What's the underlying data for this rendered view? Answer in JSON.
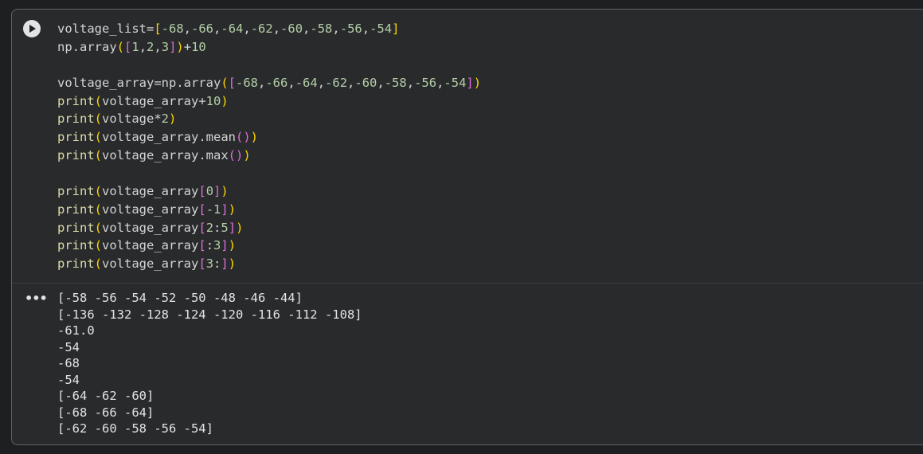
{
  "cell": {
    "run_icon": "play-icon",
    "code_lines": [
      [
        [
          "plain",
          "voltage_list="
        ],
        [
          "p1",
          "["
        ],
        [
          "num",
          "-68"
        ],
        [
          "plain",
          ","
        ],
        [
          "num",
          "-66"
        ],
        [
          "plain",
          ","
        ],
        [
          "num",
          "-64"
        ],
        [
          "plain",
          ","
        ],
        [
          "num",
          "-62"
        ],
        [
          "plain",
          ","
        ],
        [
          "num",
          "-60"
        ],
        [
          "plain",
          ","
        ],
        [
          "num",
          "-58"
        ],
        [
          "plain",
          ","
        ],
        [
          "num",
          "-56"
        ],
        [
          "plain",
          ","
        ],
        [
          "num",
          "-54"
        ],
        [
          "p1",
          "]"
        ]
      ],
      [
        [
          "plain",
          "np.array"
        ],
        [
          "p1",
          "("
        ],
        [
          "p2",
          "["
        ],
        [
          "num",
          "1"
        ],
        [
          "plain",
          ","
        ],
        [
          "num",
          "2"
        ],
        [
          "plain",
          ","
        ],
        [
          "num",
          "3"
        ],
        [
          "p2",
          "]"
        ],
        [
          "p1",
          ")"
        ],
        [
          "plain",
          "+"
        ],
        [
          "num",
          "10"
        ]
      ],
      [],
      [
        [
          "plain",
          "voltage_array=np.array"
        ],
        [
          "p1",
          "("
        ],
        [
          "p2",
          "["
        ],
        [
          "num",
          "-68"
        ],
        [
          "plain",
          ","
        ],
        [
          "num",
          "-66"
        ],
        [
          "plain",
          ","
        ],
        [
          "num",
          "-64"
        ],
        [
          "plain",
          ","
        ],
        [
          "num",
          "-62"
        ],
        [
          "plain",
          ","
        ],
        [
          "num",
          "-60"
        ],
        [
          "plain",
          ","
        ],
        [
          "num",
          "-58"
        ],
        [
          "plain",
          ","
        ],
        [
          "num",
          "-56"
        ],
        [
          "plain",
          ","
        ],
        [
          "num",
          "-54"
        ],
        [
          "p2",
          "]"
        ],
        [
          "p1",
          ")"
        ]
      ],
      [
        [
          "fn",
          "print"
        ],
        [
          "p1",
          "("
        ],
        [
          "plain",
          "voltage_array+"
        ],
        [
          "num",
          "10"
        ],
        [
          "p1",
          ")"
        ]
      ],
      [
        [
          "fn",
          "print"
        ],
        [
          "p1",
          "("
        ],
        [
          "plain",
          "voltage*"
        ],
        [
          "num",
          "2"
        ],
        [
          "p1",
          ")"
        ]
      ],
      [
        [
          "fn",
          "print"
        ],
        [
          "p1",
          "("
        ],
        [
          "plain",
          "voltage_array.mean"
        ],
        [
          "p2",
          "()"
        ],
        [
          "p1",
          ")"
        ]
      ],
      [
        [
          "fn",
          "print"
        ],
        [
          "p1",
          "("
        ],
        [
          "plain",
          "voltage_array.max"
        ],
        [
          "p2",
          "()"
        ],
        [
          "p1",
          ")"
        ]
      ],
      [],
      [
        [
          "fn",
          "print"
        ],
        [
          "p1",
          "("
        ],
        [
          "plain",
          "voltage_array"
        ],
        [
          "p2",
          "["
        ],
        [
          "num",
          "0"
        ],
        [
          "p2",
          "]"
        ],
        [
          "p1",
          ")"
        ]
      ],
      [
        [
          "fn",
          "print"
        ],
        [
          "p1",
          "("
        ],
        [
          "plain",
          "voltage_array"
        ],
        [
          "p2",
          "["
        ],
        [
          "num",
          "-1"
        ],
        [
          "p2",
          "]"
        ],
        [
          "p1",
          ")"
        ]
      ],
      [
        [
          "fn",
          "print"
        ],
        [
          "p1",
          "("
        ],
        [
          "plain",
          "voltage_array"
        ],
        [
          "p2",
          "["
        ],
        [
          "num",
          "2"
        ],
        [
          "plain",
          ":"
        ],
        [
          "num",
          "5"
        ],
        [
          "p2",
          "]"
        ],
        [
          "p1",
          ")"
        ]
      ],
      [
        [
          "fn",
          "print"
        ],
        [
          "p1",
          "("
        ],
        [
          "plain",
          "voltage_array"
        ],
        [
          "p2",
          "["
        ],
        [
          "plain",
          ":"
        ],
        [
          "num",
          "3"
        ],
        [
          "p2",
          "]"
        ],
        [
          "p1",
          ")"
        ]
      ],
      [
        [
          "fn",
          "print"
        ],
        [
          "p1",
          "("
        ],
        [
          "plain",
          "voltage_array"
        ],
        [
          "p2",
          "["
        ],
        [
          "num",
          "3"
        ],
        [
          "plain",
          ":"
        ],
        [
          "p2",
          "]"
        ],
        [
          "p1",
          ")"
        ]
      ]
    ],
    "output_menu_label": "•••",
    "output_lines": [
      "[-58 -56 -54 -52 -50 -48 -46 -44]",
      "[-136 -132 -128 -124 -120 -116 -112 -108]",
      "-61.0",
      "-54",
      "-68",
      "-54",
      "[-64 -62 -60]",
      "[-68 -66 -64]",
      "[-62 -60 -58 -56 -54]"
    ]
  },
  "colors": {
    "background": "#1e1f20",
    "cell_background": "#282a2c",
    "text": "#d4d4d4",
    "function": "#dcdcaa",
    "number": "#b5cea8",
    "bracket_level1": "#ffd700",
    "bracket_level2": "#da70d6"
  }
}
